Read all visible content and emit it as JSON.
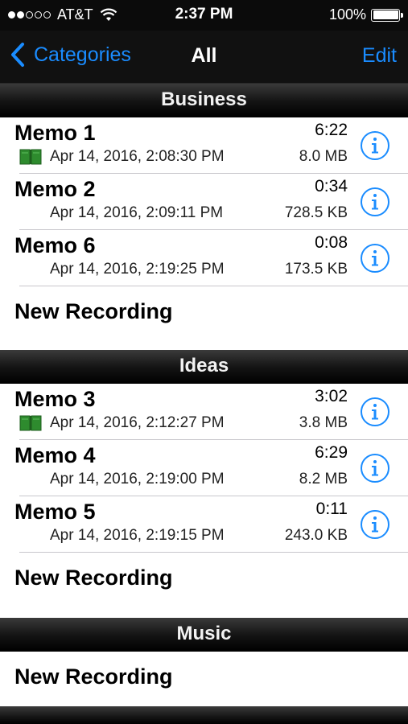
{
  "status_bar": {
    "carrier": "AT&T",
    "time": "2:37 PM",
    "battery": "100%",
    "signal_bars_filled": 2,
    "signal_bars_total": 5
  },
  "nav": {
    "back_label": "Categories",
    "title": "All",
    "edit_label": "Edit"
  },
  "colors": {
    "accent": "#1a8cff",
    "book_icon": "#2e8b2e"
  },
  "sections": [
    {
      "title": "Business",
      "memos": [
        {
          "name": "Memo 1",
          "duration": "6:22",
          "date": "Apr 14, 2016, 2:08:30 PM",
          "size": "8.0 MB",
          "has_book_icon": true
        },
        {
          "name": "Memo 2",
          "duration": "0:34",
          "date": "Apr 14, 2016, 2:09:11 PM",
          "size": "728.5 KB",
          "has_book_icon": false
        },
        {
          "name": "Memo 6",
          "duration": "0:08",
          "date": "Apr 14, 2016, 2:19:25 PM",
          "size": "173.5 KB",
          "has_book_icon": false
        }
      ],
      "new_recording_label": "New Recording"
    },
    {
      "title": "Ideas",
      "memos": [
        {
          "name": "Memo 3",
          "duration": "3:02",
          "date": "Apr 14, 2016, 2:12:27 PM",
          "size": "3.8 MB",
          "has_book_icon": true
        },
        {
          "name": "Memo 4",
          "duration": "6:29",
          "date": "Apr 14, 2016, 2:19:00 PM",
          "size": "8.2 MB",
          "has_book_icon": false
        },
        {
          "name": "Memo 5",
          "duration": "0:11",
          "date": "Apr 14, 2016, 2:19:15 PM",
          "size": "243.0 KB",
          "has_book_icon": false
        }
      ],
      "new_recording_label": "New Recording"
    },
    {
      "title": "Music",
      "memos": [],
      "new_recording_label": "New Recording"
    }
  ],
  "icons": {
    "back": "chevron-left-icon",
    "info": "info-circle-icon",
    "book": "book-icon",
    "wifi": "wifi-icon",
    "battery": "battery-icon"
  }
}
